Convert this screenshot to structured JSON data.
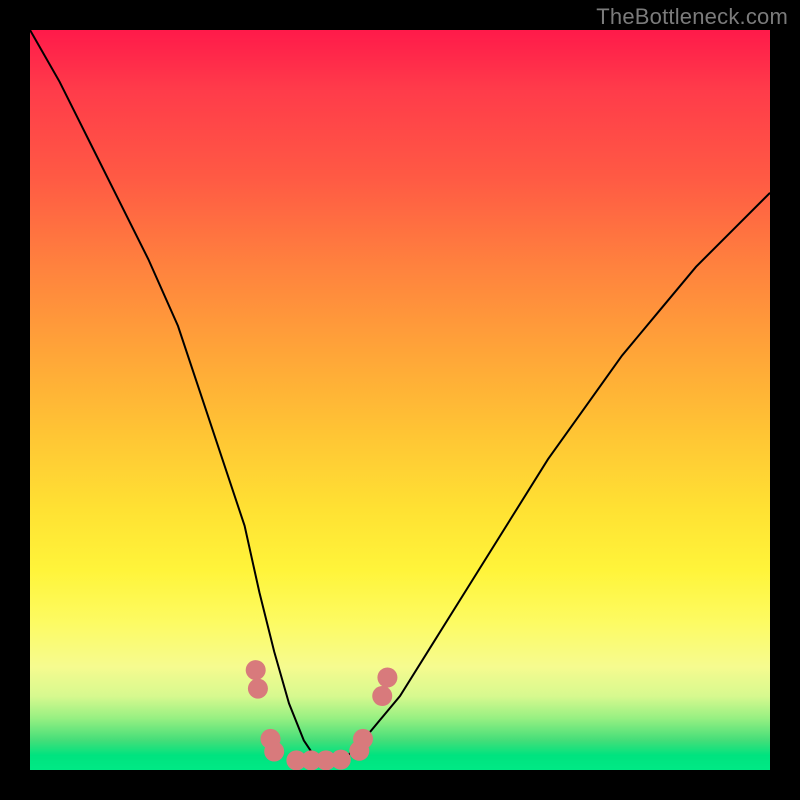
{
  "watermark": "TheBottleneck.com",
  "colors": {
    "frame": "#000000",
    "curve": "#000000",
    "markers": "#d87a7c",
    "marker_fill": "#d87a7c"
  },
  "chart_data": {
    "type": "line",
    "title": "",
    "xlabel": "",
    "ylabel": "",
    "xlim": [
      0,
      100
    ],
    "ylim": [
      0,
      100
    ],
    "series": [
      {
        "name": "bottleneck-curve",
        "x": [
          0,
          4,
          8,
          12,
          16,
          20,
          23,
          26,
          29,
          31,
          33,
          35,
          37,
          39,
          42,
          45,
          50,
          55,
          60,
          65,
          70,
          75,
          80,
          85,
          90,
          95,
          100
        ],
        "y": [
          100,
          93,
          85,
          77,
          69,
          60,
          51,
          42,
          33,
          24,
          16,
          9,
          4,
          1,
          1,
          4,
          10,
          18,
          26,
          34,
          42,
          49,
          56,
          62,
          68,
          73,
          78
        ]
      }
    ],
    "markers": [
      {
        "x": 30.5,
        "y": 13.5
      },
      {
        "x": 30.8,
        "y": 11.0
      },
      {
        "x": 32.5,
        "y": 4.2
      },
      {
        "x": 33.0,
        "y": 2.5
      },
      {
        "x": 36.0,
        "y": 1.3
      },
      {
        "x": 38.0,
        "y": 1.3
      },
      {
        "x": 40.0,
        "y": 1.3
      },
      {
        "x": 42.0,
        "y": 1.4
      },
      {
        "x": 44.5,
        "y": 2.6
      },
      {
        "x": 45.0,
        "y": 4.2
      },
      {
        "x": 47.6,
        "y": 10.0
      },
      {
        "x": 48.3,
        "y": 12.5
      }
    ],
    "background_gradient": {
      "top": "#ff1a4a",
      "mid_upper": "#ffa638",
      "mid": "#fff43a",
      "mid_lower": "#d7f98f",
      "bottom": "#00e985"
    }
  }
}
